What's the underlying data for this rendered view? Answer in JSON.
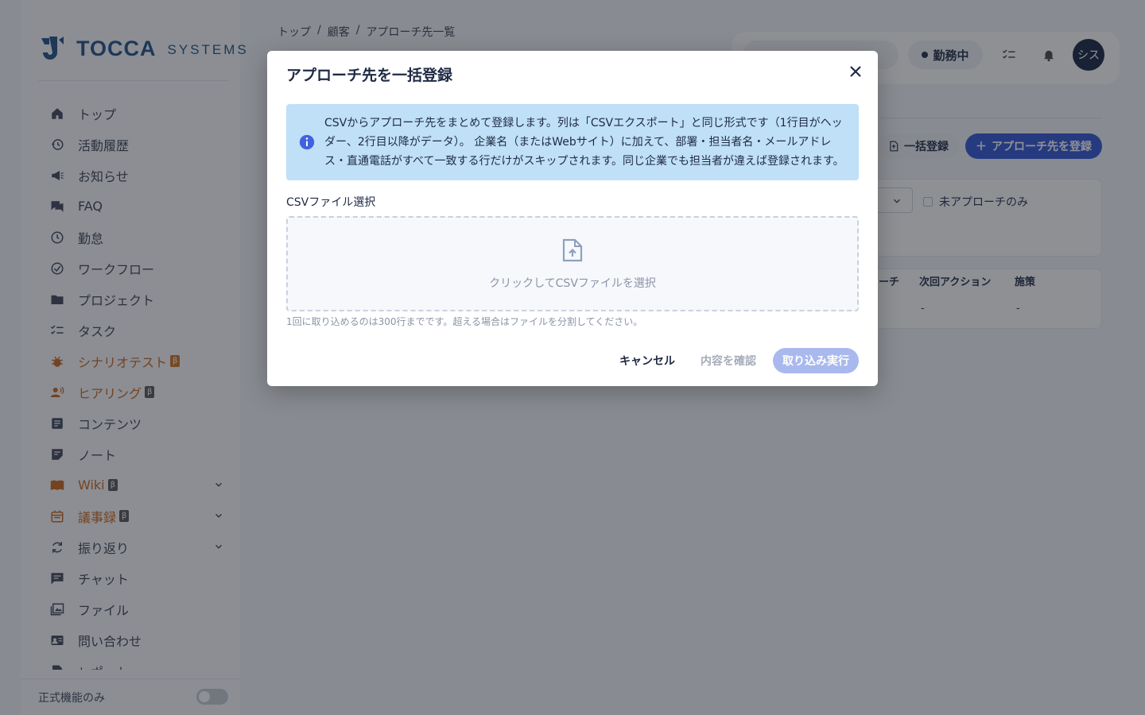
{
  "sidebar": {
    "brand_word": "TOCCA",
    "brand_sub": "SYSTEMS",
    "items": [
      {
        "label": "トップ"
      },
      {
        "label": "活動履歴"
      },
      {
        "label": "お知らせ"
      },
      {
        "label": "FAQ"
      },
      {
        "label": "勤怠"
      },
      {
        "label": "ワークフロー"
      },
      {
        "label": "プロジェクト"
      },
      {
        "label": "タスク"
      },
      {
        "label": "シナリオテスト",
        "badge": "β"
      },
      {
        "label": "ヒアリング",
        "badge": "β"
      },
      {
        "label": "コンテンツ"
      },
      {
        "label": "ノート"
      },
      {
        "label": "Wiki",
        "badge": "β"
      },
      {
        "label": "議事録",
        "badge": "β"
      },
      {
        "label": "振り返り"
      },
      {
        "label": "チャット"
      },
      {
        "label": "ファイル"
      },
      {
        "label": "問い合わせ"
      },
      {
        "label": "レポート"
      }
    ],
    "footer_label": "正式機能のみ"
  },
  "breadcrumb": [
    "トップ",
    "顧客",
    "アプローチ先一覧"
  ],
  "header": {
    "status_label": "勤務中",
    "avatar_text": "シス"
  },
  "toolbar": {
    "bulk_label": "一括登録",
    "add_label": "アプローチ先を登録"
  },
  "filters": {
    "unapproached_only": "未アプローチのみ"
  },
  "table": {
    "headers": [
      "ーチ",
      "次回アクション",
      "施策"
    ],
    "row": [
      "-",
      "-"
    ]
  },
  "modal": {
    "title": "アプローチ先を一括登録",
    "info": "CSVからアプローチ先をまとめて登録します。列は「CSVエクスポート」と同じ形式です（1行目がヘッダー、2行目以降がデータ）。 企業名（またはWebサイト）に加えて、部署・担当者名・メールアドレス・直通電話がすべて一致する行だけがスキップされます。同じ企業でも担当者が違えば登録されます。",
    "field_label": "CSVファイル選択",
    "dropzone_text": "クリックしてCSVファイルを選択",
    "hint": "1回に取り込めるのは300行までです。超える場合はファイルを分割してください。",
    "cancel_label": "キャンセル",
    "confirm_label": "内容を確認",
    "run_label": "取り込み実行"
  }
}
